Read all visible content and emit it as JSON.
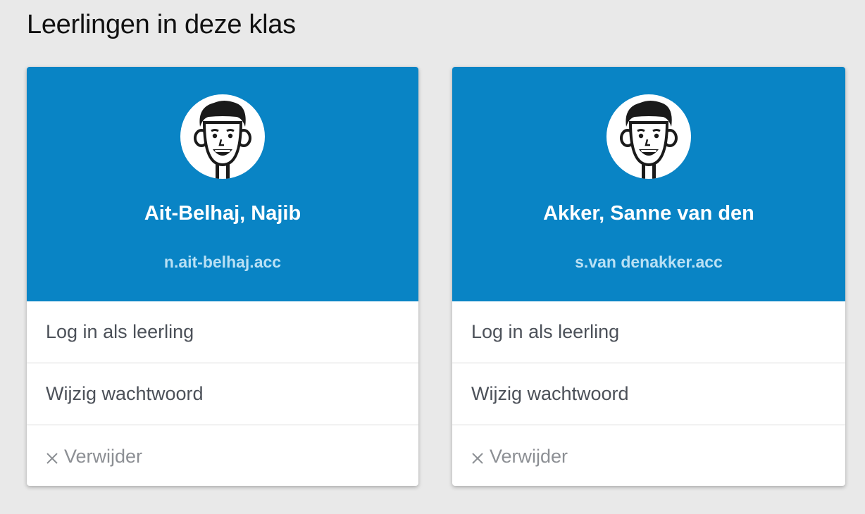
{
  "page": {
    "title": "Leerlingen in deze klas"
  },
  "theme": {
    "card_header_color": "#0984c5",
    "username_color": "#b9e0f4",
    "background": "#e9e9e9"
  },
  "students": [
    {
      "name": "Ait-Belhaj, Najib",
      "username": "n.ait-belhaj.acc",
      "avatar_icon": "boy-avatar-icon",
      "actions": {
        "login_label": "Log in als leerling",
        "password_label": "Wijzig wachtwoord",
        "remove_label": "Verwijder",
        "remove_icon": "close-icon"
      }
    },
    {
      "name": "Akker, Sanne van den",
      "username": "s.van denakker.acc",
      "avatar_icon": "boy-avatar-icon",
      "actions": {
        "login_label": "Log in als leerling",
        "password_label": "Wijzig wachtwoord",
        "remove_label": "Verwijder",
        "remove_icon": "close-icon"
      }
    }
  ]
}
